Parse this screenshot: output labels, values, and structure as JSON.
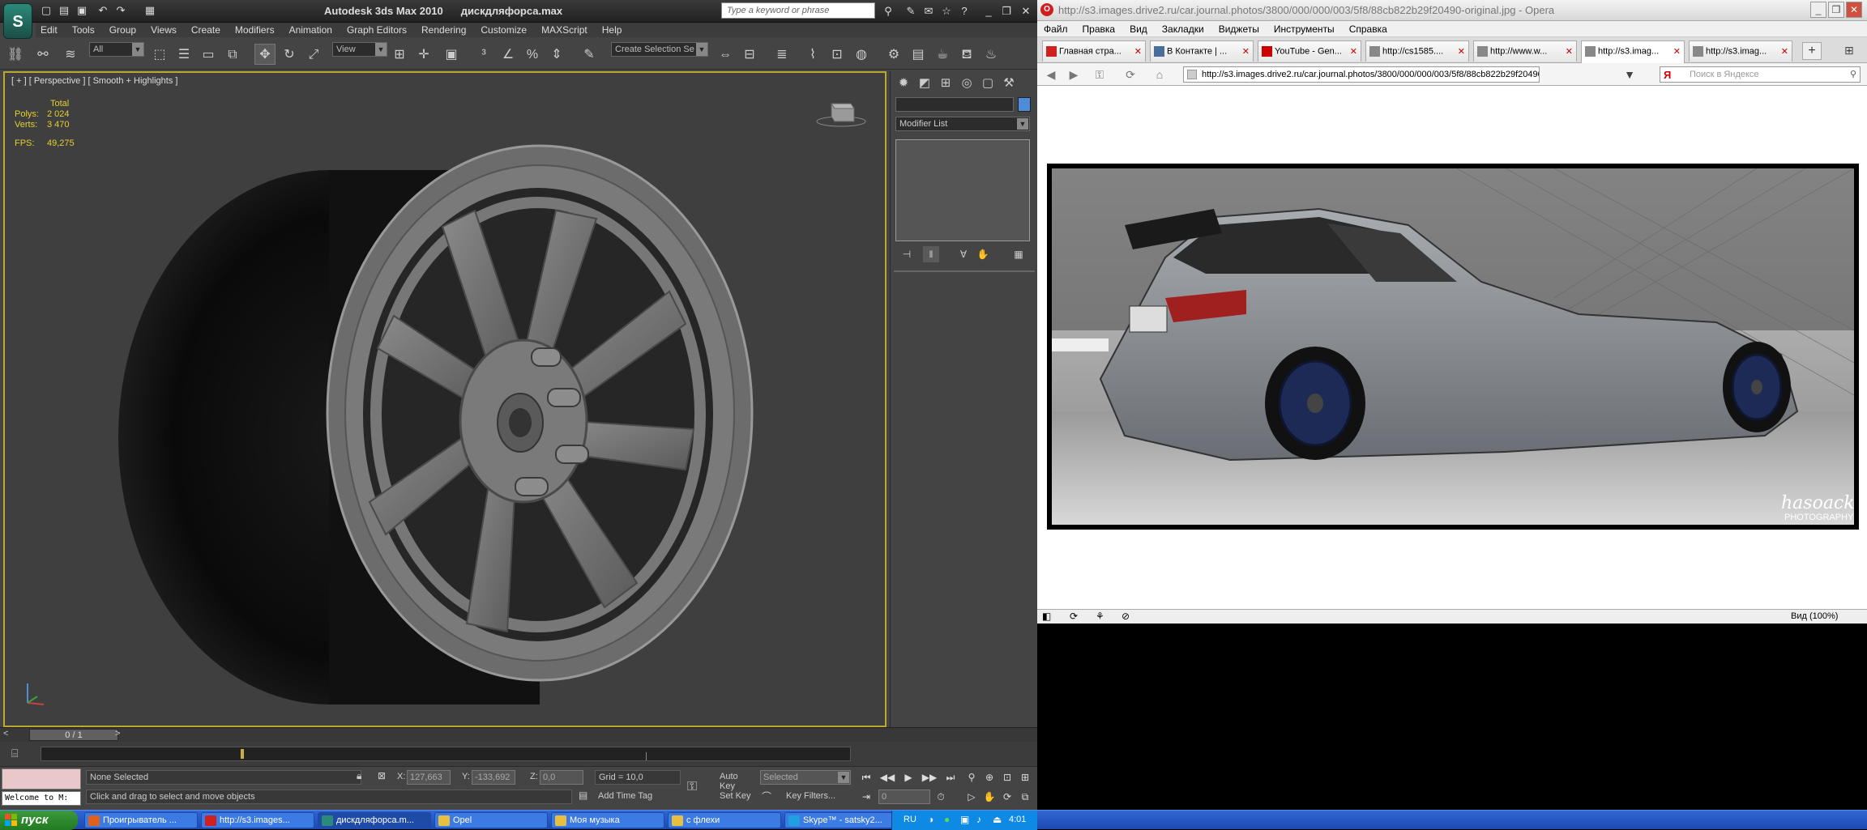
{
  "max": {
    "title": "Autodesk 3ds Max  2010",
    "file": "дискдляфорса.max",
    "search_placeholder": "Type a keyword or phrase",
    "logo": "3ds-max-logo",
    "menu": [
      "Edit",
      "Tools",
      "Group",
      "Views",
      "Create",
      "Modifiers",
      "Animation",
      "Graph Editors",
      "Rendering",
      "Customize",
      "MAXScript",
      "Help"
    ],
    "filter_combo": "All",
    "ref_coord_combo": "View",
    "selection_set_combo": "Create Selection Se",
    "viewport": {
      "label": "[ + ] [ Perspective ] [ Smooth + Highlights ]",
      "stats_header": "Total",
      "polys_label": "Polys:",
      "polys_value": "2 024",
      "verts_label": "Verts:",
      "verts_value": "3 470",
      "fps_label": "FPS:",
      "fps_value": "49,275"
    },
    "command_panel": {
      "modifier_list": "Modifier List",
      "accent": "#4c8cd8"
    },
    "timeline": {
      "frame_label": "0 / 1"
    },
    "status": {
      "welcome": "Welcome to M:",
      "selection": "None Selected",
      "prompt": "Click and drag to select and move objects",
      "x_label": "X:",
      "x_value": "127,663",
      "y_label": "Y:",
      "y_value": "-133,692",
      "z_label": "Z:",
      "z_value": "0,0",
      "grid": "Grid = 10,0",
      "add_time_tag": "Add Time Tag",
      "auto_key": "Auto Key",
      "set_key": "Set Key",
      "key_mode": "Selected",
      "key_filters": "Key Filters...",
      "frame": "0"
    }
  },
  "opera": {
    "title": "http://s3.images.drive2.ru/car.journal.photos/3800/000/000/003/5f8/88cb822b29f20490-original.jpg - Opera",
    "menu": [
      "Файл",
      "Правка",
      "Вид",
      "Закладки",
      "Виджеты",
      "Инструменты",
      "Справка"
    ],
    "tabs": [
      {
        "label": "Главная стра...",
        "icon_color": "#d02020"
      },
      {
        "label": "В Контакте | ...",
        "icon_color": "#4a6e9a"
      },
      {
        "label": "YouTube - Gen...",
        "icon_color": "#cc0000"
      },
      {
        "label": "http://cs1585....",
        "icon_color": "#888888"
      },
      {
        "label": "http://www.w...",
        "icon_color": "#888888"
      },
      {
        "label": "http://s3.imag...",
        "icon_color": "#888888"
      },
      {
        "label": "http://s3.imag...",
        "icon_color": "#888888"
      }
    ],
    "active_tab": 5,
    "url": "http://s3.images.drive2.ru/car.journal.photos/3800/000/000/003/5f8/88cb822b29f20490-original.jpg",
    "search_placeholder": "Поиск в Яндексе",
    "zoom": "Вид (100%)",
    "photo_watermark_1": "hasoack",
    "photo_watermark_2": "PHOTOGRAPHY"
  },
  "taskbar": {
    "start": "пуск",
    "tasks": [
      {
        "label": "Проигрыватель ...",
        "icon_color": "#e06020"
      },
      {
        "label": "http://s3.images...",
        "icon_color": "#d02020"
      },
      {
        "label": "дискдляфорса.m...",
        "icon_color": "#2c8a7a"
      },
      {
        "label": "Opel",
        "icon_color": "#e8c040"
      },
      {
        "label": "Моя музыка",
        "icon_color": "#e8c040"
      },
      {
        "label": "с флехи",
        "icon_color": "#e8c040"
      },
      {
        "label": "Skype™ - satsky2...",
        "icon_color": "#20a0e0"
      }
    ],
    "active_task": 2,
    "lang": "RU",
    "clock": "4:01"
  }
}
